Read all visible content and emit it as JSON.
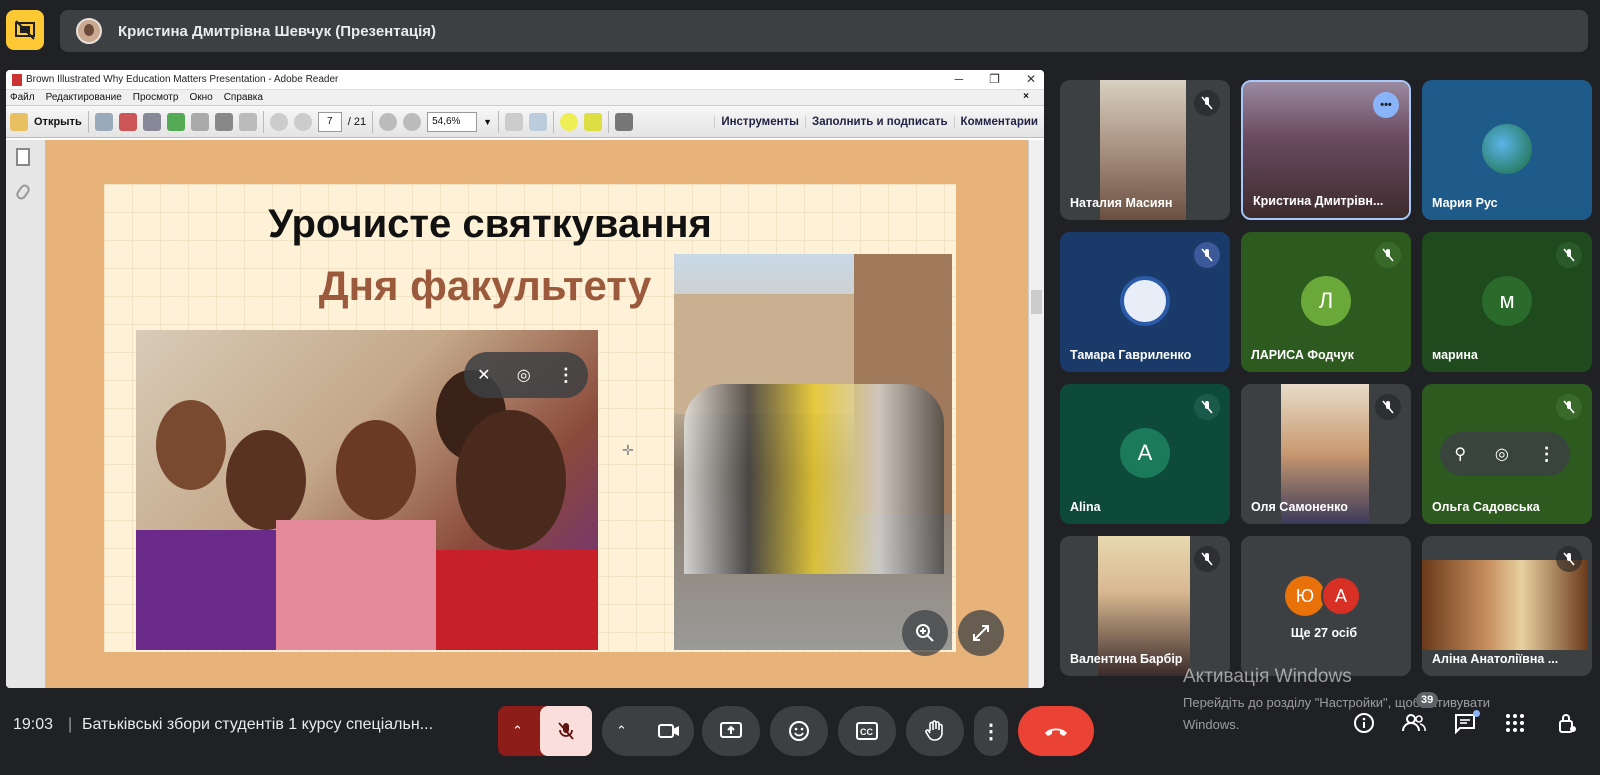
{
  "header": {
    "presenter_name": "Кристина Дмитрівна Шевчук (Презентація)"
  },
  "acrobat": {
    "window_title": "Brown Illustrated Why Education Matters Presentation - Adobe Reader",
    "menu": [
      "Файл",
      "Редактирование",
      "Просмотр",
      "Окно",
      "Справка"
    ],
    "open_label": "Открыть",
    "page_current": "7",
    "page_total": "/ 21",
    "zoom": "54,6%",
    "tools_label": "Инструменты",
    "fill_sign_label": "Заполнить и подписать",
    "comments_label": "Комментарии"
  },
  "slide": {
    "title_line1": "Урочисте святкування",
    "title_line2": "Дня факультету"
  },
  "participants": [
    {
      "name": "Наталия Масиян",
      "muted": true,
      "kind": "video"
    },
    {
      "name": "Кристина Дмитрівн...",
      "muted": false,
      "kind": "video",
      "speaking": true
    },
    {
      "name": "Мария Рус",
      "muted": false,
      "kind": "avatar"
    },
    {
      "name": "Тамара Гавриленко",
      "muted": true,
      "kind": "avatar"
    },
    {
      "name": "ЛАРИСА Фодчук",
      "muted": true,
      "kind": "letter",
      "letter": "Л"
    },
    {
      "name": "марина",
      "muted": true,
      "kind": "letter",
      "letter": "м"
    },
    {
      "name": "Alina",
      "muted": true,
      "kind": "letter",
      "letter": "A"
    },
    {
      "name": "Оля Самоненко",
      "muted": true,
      "kind": "video"
    },
    {
      "name": "Ольга Садовська",
      "muted": true,
      "kind": "hover"
    },
    {
      "name": "Валентина Барбір",
      "muted": true,
      "kind": "video"
    },
    {
      "name": "Ще 27 осіб",
      "muted": false,
      "kind": "more",
      "letters": [
        "Ю",
        "А"
      ]
    },
    {
      "name": "Аліна Анатоліївна ...",
      "muted": true,
      "kind": "video"
    }
  ],
  "bottom": {
    "time": "19:03",
    "separator": "|",
    "meeting_title": "Батьківські збори студентів 1 курсу спеціальн...",
    "people_count": "39"
  },
  "windows_activation": {
    "title": "Активація Windows",
    "line1": "Перейдіть до розділу \"Настройки\", щоб активувати",
    "line2": "Windows."
  },
  "colors": {
    "end_call": "#ea4335",
    "mic_off": "#f9dedc",
    "accent": "#8ab4f8"
  }
}
